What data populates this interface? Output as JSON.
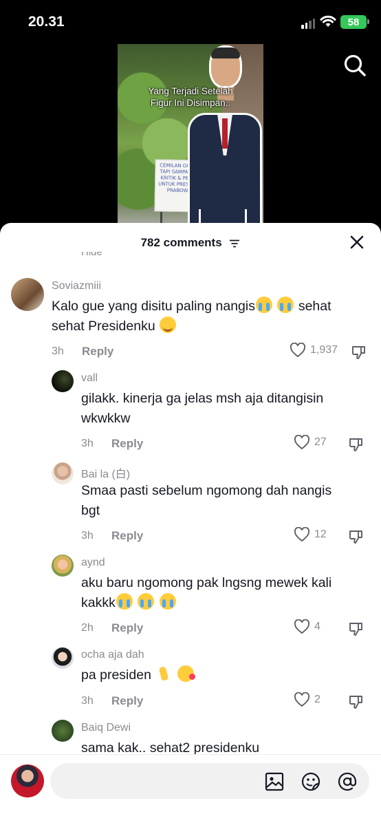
{
  "status_bar": {
    "time": "20.31",
    "battery": "58"
  },
  "video": {
    "caption_line1": "Yang Terjadi Setelah",
    "caption_line2": "Figur Ini Disimpan..",
    "sign_text": "CEMILAN GRATIS TAPI SAMPAIKAN KRITIK & PESAN UNTUK PRESIDEN PRABOWO"
  },
  "sheet": {
    "title": "782 comments",
    "hide_peek": "Hide"
  },
  "comments": [
    {
      "username": "Soviazmiii",
      "line1": "Kalo gue yang disitu paling nangis",
      "line2": "sehat Presidenku",
      "between": "sehat",
      "time": "3h",
      "reply": "Reply",
      "likes": "1,937"
    },
    {
      "username": "vall",
      "line1": "gilakk. kinerja ga jelas msh aja ditangisin",
      "line2": "wkwkkw",
      "time": "3h",
      "reply": "Reply",
      "likes": "27"
    },
    {
      "username": "Bai la (白)",
      "line1": "Smaa pasti sebelum ngomong dah nangis",
      "line2": "bgt",
      "time": "3h",
      "reply": "Reply",
      "likes": "12"
    },
    {
      "username": "aynd",
      "line1": "aku baru ngomong pak lngsng mewek kali",
      "line2": "kakkk",
      "time": "2h",
      "reply": "Reply",
      "likes": "4"
    },
    {
      "username": "ocha aja dah",
      "line1": "pa presiden",
      "time": "3h",
      "reply": "Reply",
      "likes": "2"
    },
    {
      "username": "Baiq Dewi",
      "line1": "sama kak.. sehat2 presidenku"
    }
  ],
  "input": {
    "placeholder": ""
  },
  "icons": {
    "search": "search-icon",
    "filter": "filter-icon",
    "close": "close-icon",
    "heart": "heart-icon",
    "dislike": "thumbs-down-icon",
    "image": "image-icon",
    "sticker": "sticker-icon",
    "mention": "at-icon"
  }
}
